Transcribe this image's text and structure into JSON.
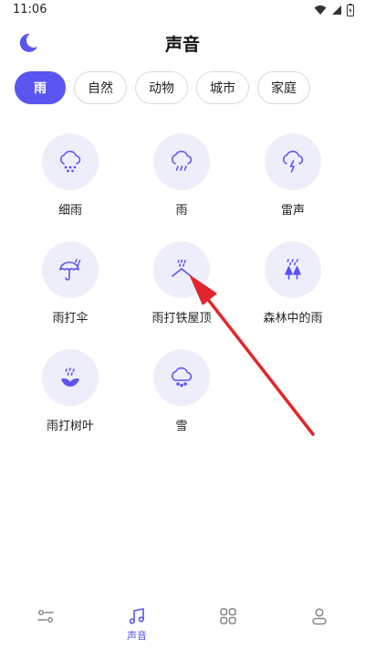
{
  "status": {
    "time": "11:06"
  },
  "header": {
    "title": "声音"
  },
  "tabs": [
    {
      "label": "雨",
      "active": true
    },
    {
      "label": "自然",
      "active": false
    },
    {
      "label": "动物",
      "active": false
    },
    {
      "label": "城市",
      "active": false
    },
    {
      "label": "家庭",
      "active": false
    }
  ],
  "sounds": [
    {
      "label": "细雨",
      "icon": "drizzle-cloud-icon"
    },
    {
      "label": "雨",
      "icon": "rain-cloud-icon"
    },
    {
      "label": "雷声",
      "icon": "thunder-cloud-icon"
    },
    {
      "label": "雨打伞",
      "icon": "umbrella-rain-icon"
    },
    {
      "label": "雨打铁屋顶",
      "icon": "roof-rain-icon"
    },
    {
      "label": "森林中的雨",
      "icon": "forest-rain-icon"
    },
    {
      "label": "雨打树叶",
      "icon": "leaves-rain-icon"
    },
    {
      "label": "雪",
      "icon": "snow-cloud-icon"
    }
  ],
  "bottom_nav": [
    {
      "label": "",
      "icon": "sliders-icon",
      "active": false
    },
    {
      "label": "声音",
      "icon": "music-note-icon",
      "active": true
    },
    {
      "label": "",
      "icon": "grid-apps-icon",
      "active": false
    },
    {
      "label": "",
      "icon": "user-icon",
      "active": false
    }
  ],
  "colors": {
    "accent": "#5a55f0",
    "icon_bg": "#eeeefb",
    "icon_stroke": "#5a55f0",
    "annotation_arrow": "#e0262a"
  }
}
